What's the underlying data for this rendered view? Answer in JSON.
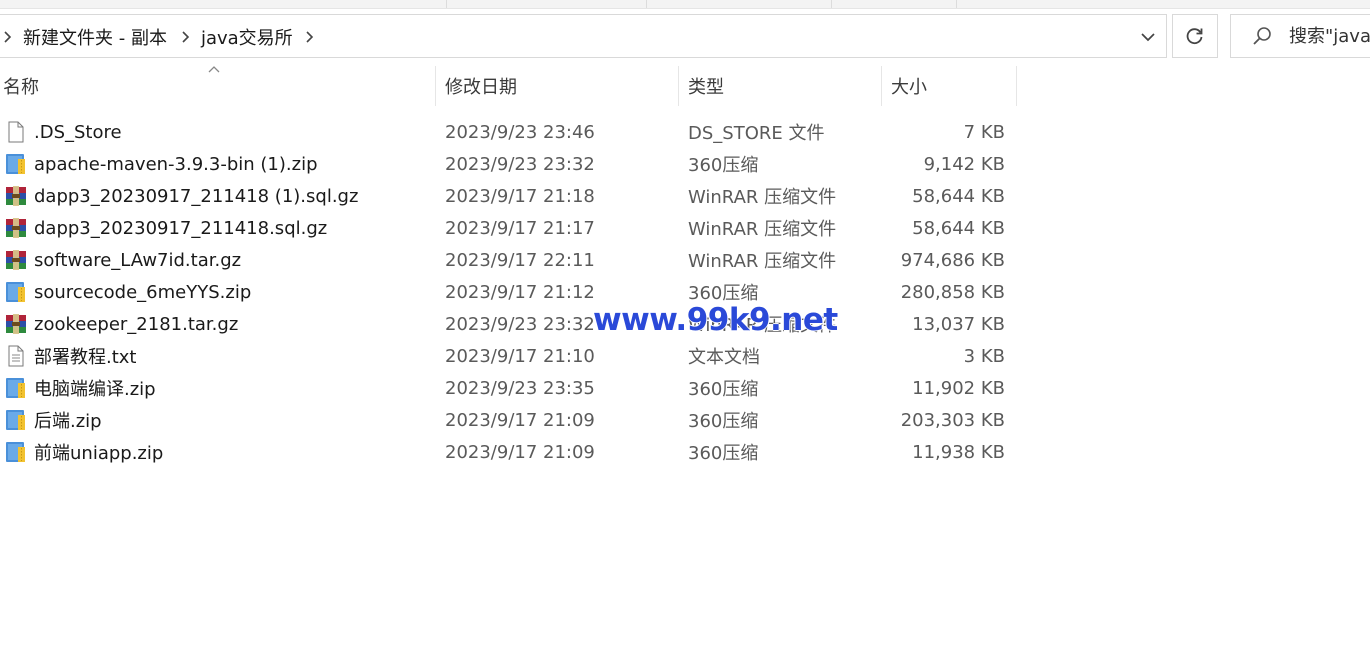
{
  "address_bar": {
    "breadcrumbs": [
      {
        "label": "新建文件夹 - 副本"
      },
      {
        "label": "java交易所"
      }
    ]
  },
  "search": {
    "placeholder": "搜索\"java"
  },
  "columns": {
    "name": "名称",
    "date": "修改日期",
    "type": "类型",
    "size": "大小"
  },
  "files": [
    {
      "name": ".DS_Store",
      "date": "2023/9/23 23:46",
      "type": "DS_STORE 文件",
      "size": "7 KB",
      "icon": "blank-file-icon"
    },
    {
      "name": "apache-maven-3.9.3-bin (1).zip",
      "date": "2023/9/23 23:32",
      "type": "360压缩",
      "size": "9,142 KB",
      "icon": "zip-archive-icon"
    },
    {
      "name": "dapp3_20230917_211418 (1).sql.gz",
      "date": "2023/9/17 21:18",
      "type": "WinRAR 压缩文件",
      "size": "58,644 KB",
      "icon": "winrar-archive-icon"
    },
    {
      "name": "dapp3_20230917_211418.sql.gz",
      "date": "2023/9/17 21:17",
      "type": "WinRAR 压缩文件",
      "size": "58,644 KB",
      "icon": "winrar-archive-icon"
    },
    {
      "name": "software_LAw7id.tar.gz",
      "date": "2023/9/17 22:11",
      "type": "WinRAR 压缩文件",
      "size": "974,686 KB",
      "icon": "winrar-archive-icon"
    },
    {
      "name": "sourcecode_6meYYS.zip",
      "date": "2023/9/17 21:12",
      "type": "360压缩",
      "size": "280,858 KB",
      "icon": "zip-archive-icon"
    },
    {
      "name": "zookeeper_2181.tar.gz",
      "date": "2023/9/23 23:32",
      "type": "WinRAR 压缩文件",
      "size": "13,037 KB",
      "icon": "winrar-archive-icon"
    },
    {
      "name": "部署教程.txt",
      "date": "2023/9/17 21:10",
      "type": "文本文档",
      "size": "3 KB",
      "icon": "text-file-icon"
    },
    {
      "name": "电脑端编译.zip",
      "date": "2023/9/23 23:35",
      "type": "360压缩",
      "size": "11,902 KB",
      "icon": "zip-archive-icon"
    },
    {
      "name": "后端.zip",
      "date": "2023/9/17 21:09",
      "type": "360压缩",
      "size": "203,303 KB",
      "icon": "zip-archive-icon"
    },
    {
      "name": "前端uniapp.zip",
      "date": "2023/9/17 21:09",
      "type": "360压缩",
      "size": "11,938 KB",
      "icon": "zip-archive-icon"
    }
  ],
  "watermark": "www.99k9.net",
  "colors": {
    "zip_blue": "#4a90d9",
    "zip_yellow": "#f2c230",
    "winrar_red": "#b0243a",
    "winrar_blue": "#2c4fa8",
    "winrar_green": "#2e8a3e",
    "watermark_blue": "#2a49d8"
  }
}
